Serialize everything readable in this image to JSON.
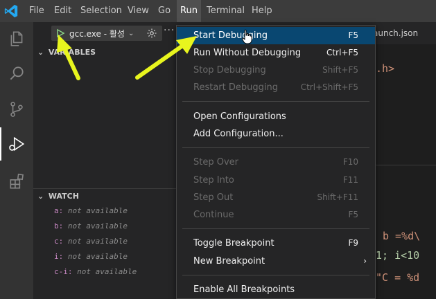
{
  "menubar": {
    "logo_icon": "vscode-logo-icon",
    "items": [
      {
        "label": "File"
      },
      {
        "label": "Edit"
      },
      {
        "label": "Selection"
      },
      {
        "label": "View"
      },
      {
        "label": "Go"
      },
      {
        "label": "Run"
      },
      {
        "label": "Terminal"
      },
      {
        "label": "Help"
      }
    ],
    "active": "Run"
  },
  "activitybar": {
    "icons": [
      "files-icon",
      "search-icon",
      "source-control-icon",
      "run-debug-icon",
      "extensions-icon"
    ],
    "active": "run-debug-icon"
  },
  "debug_toolbar": {
    "config_label": "gcc.exe - 활성",
    "play_icon": "play-icon",
    "gear_icon": "gear-icon",
    "more_label": "···"
  },
  "sidebar": {
    "variables_header": "VARIABLES",
    "watch_header": "WATCH",
    "watch_items": [
      {
        "name": "a:",
        "value": "not available"
      },
      {
        "name": "b:",
        "value": "not available"
      },
      {
        "name": "c:",
        "value": "not available"
      },
      {
        "name": "i:",
        "value": "not available"
      },
      {
        "name": "c-i:",
        "value": "not available"
      }
    ]
  },
  "editor": {
    "tab_label": "aunch.json",
    "code_lines": [
      ".h>",
      "b =%d\\",
      "1; i<10",
      "\"C = %d"
    ]
  },
  "run_menu": {
    "items": [
      {
        "label": "Start Debugging",
        "key": "F5",
        "state": "highlight"
      },
      {
        "label": "Run Without Debugging",
        "key": "Ctrl+F5",
        "state": "enabled"
      },
      {
        "label": "Stop Debugging",
        "key": "Shift+F5",
        "state": "disabled"
      },
      {
        "label": "Restart Debugging",
        "key": "Ctrl+Shift+F5",
        "state": "disabled"
      },
      {
        "label": "Open Configurations",
        "key": "",
        "state": "enabled"
      },
      {
        "label": "Add Configuration...",
        "key": "",
        "state": "enabled"
      },
      {
        "label": "Step Over",
        "key": "F10",
        "state": "disabled"
      },
      {
        "label": "Step Into",
        "key": "F11",
        "state": "disabled"
      },
      {
        "label": "Step Out",
        "key": "Shift+F11",
        "state": "disabled"
      },
      {
        "label": "Continue",
        "key": "F5",
        "state": "disabled"
      },
      {
        "label": "Toggle Breakpoint",
        "key": "F9",
        "state": "enabled"
      },
      {
        "label": "New Breakpoint",
        "key": "",
        "state": "enabled"
      },
      {
        "label": "Enable All Breakpoints",
        "key": "",
        "state": "enabled"
      }
    ],
    "submenu_arrow": "›"
  },
  "colors": {
    "annotation_arrow": "#e8f51e",
    "menu_highlight": "#094771"
  }
}
